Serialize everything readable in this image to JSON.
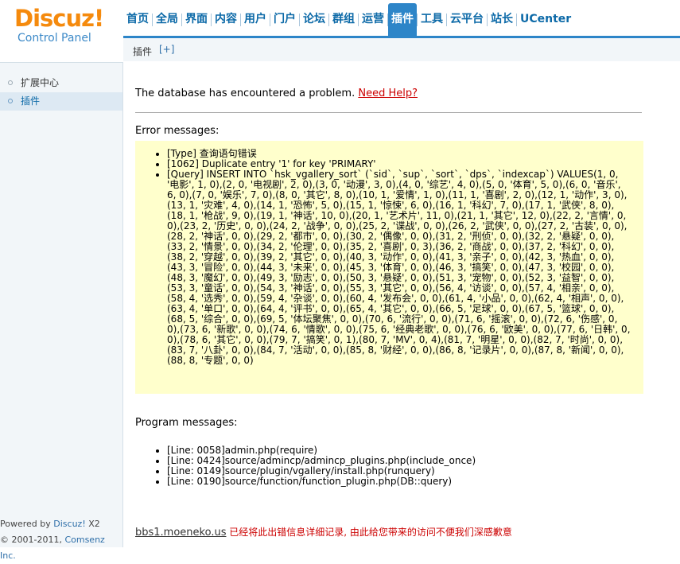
{
  "logo": {
    "brand": "Discuz!",
    "subtitle": "Control Panel"
  },
  "topnav": [
    {
      "label": "首页",
      "active": false
    },
    {
      "label": "全局",
      "active": false
    },
    {
      "label": "界面",
      "active": false
    },
    {
      "label": "内容",
      "active": false
    },
    {
      "label": "用户",
      "active": false
    },
    {
      "label": "门户",
      "active": false
    },
    {
      "label": "论坛",
      "active": false
    },
    {
      "label": "群组",
      "active": false
    },
    {
      "label": "运营",
      "active": false
    },
    {
      "label": "插件",
      "active": true
    },
    {
      "label": "工具",
      "active": false
    },
    {
      "label": "云平台",
      "active": false
    },
    {
      "label": "站长",
      "active": false
    },
    {
      "label": "UCenter",
      "active": false
    }
  ],
  "subbar": {
    "item": "插件",
    "plus": "[+]"
  },
  "sidebar": {
    "items": [
      {
        "label": "扩展中心"
      },
      {
        "label": "插件"
      }
    ]
  },
  "powered": {
    "prefix": "Powered by ",
    "brand": "Discuz!",
    "version": " X2",
    "copy": "© 2001-2011, ",
    "company": "Comsenz Inc."
  },
  "main": {
    "problem_text": "The database has encountered a problem. ",
    "help_link": "Need Help?",
    "error_label": "Error messages:",
    "errors": [
      "[Type] 查询语句错误",
      "[1062] Duplicate entry '1' for key 'PRIMARY'",
      "[Query] INSERT INTO `hsk_vgallery_sort` (`sid`, `sup`, `sort`, `dps`, `indexcap`) VALUES(1, 0, '电影', 1, 0),(2, 0, '电视剧', 2, 0),(3, 0, '动漫', 3, 0),(4, 0, '综艺', 4, 0),(5, 0, '体育', 5, 0),(6, 0, '音乐', 6, 0),(7, 0, '娱乐', 7, 0),(8, 0, '其它', 8, 0),(10, 1, '爱情', 1, 0),(11, 1, '喜剧', 2, 0),(12, 1, '动作', 3, 0),(13, 1, '灾难', 4, 0),(14, 1, '恐怖', 5, 0),(15, 1, '惊悚', 6, 0),(16, 1, '科幻', 7, 0),(17, 1, '武侠', 8, 0),(18, 1, '枪战', 9, 0),(19, 1, '神话', 10, 0),(20, 1, '艺术片', 11, 0),(21, 1, '其它', 12, 0),(22, 2, '言情', 0, 0),(23, 2, '历史', 0, 0),(24, 2, '战争', 0, 0),(25, 2, '谍战', 0, 0),(26, 2, '武侠', 0, 0),(27, 2, '古装', 0, 0),(28, 2, '神话', 0, 0),(29, 2, '都市', 0, 0),(30, 2, '偶像', 0, 0),(31, 2, '刑侦', 0, 0),(32, 2, '悬疑', 0, 0),(33, 2, '情景', 0, 0),(34, 2, '伦理', 0, 0),(35, 2, '喜剧', 0, 3),(36, 2, '商战', 0, 0),(37, 2, '科幻', 0, 0),(38, 2, '穿越', 0, 0),(39, 2, '其它', 0, 0),(40, 3, '动作', 0, 0),(41, 3, '亲子', 0, 0),(42, 3, '热血', 0, 0),(43, 3, '冒险', 0, 0),(44, 3, '未来', 0, 0),(45, 3, '体育', 0, 0),(46, 3, '搞笑', 0, 0),(47, 3, '校园', 0, 0),(48, 3, '魔幻', 0, 0),(49, 3, '励志', 0, 0),(50, 3, '悬疑', 0, 0),(51, 3, '宠物', 0, 0),(52, 3, '益智', 0, 0),(53, 3, '童话', 0, 0),(54, 3, '神话', 0, 0),(55, 3, '其它', 0, 0),(56, 4, '访谈', 0, 0),(57, 4, '相亲', 0, 0),(58, 4, '选秀', 0, 0),(59, 4, '杂谈', 0, 0),(60, 4, '发布会', 0, 0),(61, 4, '小品', 0, 0),(62, 4, '相声', 0, 0),(63, 4, '单口', 0, 0),(64, 4, '评书', 0, 0),(65, 4, '其它', 0, 0),(66, 5, '足球', 0, 0),(67, 5, '篮球', 0, 0),(68, 5, '综合', 0, 0),(69, 5, '体坛聚焦', 0, 0),(70, 6, '流行', 0, 0),(71, 6, '摇滚', 0, 0),(72, 6, '伤感', 0, 0),(73, 6, '新歌', 0, 0),(74, 6, '情歌', 0, 0),(75, 6, '经典老歌', 0, 0),(76, 6, '欧美', 0, 0),(77, 6, '日韩', 0, 0),(78, 6, '其它', 0, 0),(79, 7, '搞笑', 0, 1),(80, 7, 'MV', 0, 4),(81, 7, '明星', 0, 0),(82, 7, '时尚', 0, 0),(83, 7, '八卦', 0, 0),(84, 7, '活动', 0, 0),(85, 8, '财经', 0, 0),(86, 8, '记录片', 0, 0),(87, 8, '新闻', 0, 0),(88, 8, '专题', 0, 0)"
    ],
    "program_label": "Program messages:",
    "program": [
      "[Line: 0058]admin.php(require)",
      "[Line: 0424]source/admincp/admincp_plugins.php(include_once)",
      "[Line: 0149]source/plugin/vgallery/install.php(runquery)",
      "[Line: 0190]source/function/function_plugin.php(DB::query)"
    ],
    "footer_site": "bbs1.moeneko.us",
    "footer_note": " 已经将此出错信息详细记录, 由此给您带来的访问不便我们深感歉意"
  }
}
